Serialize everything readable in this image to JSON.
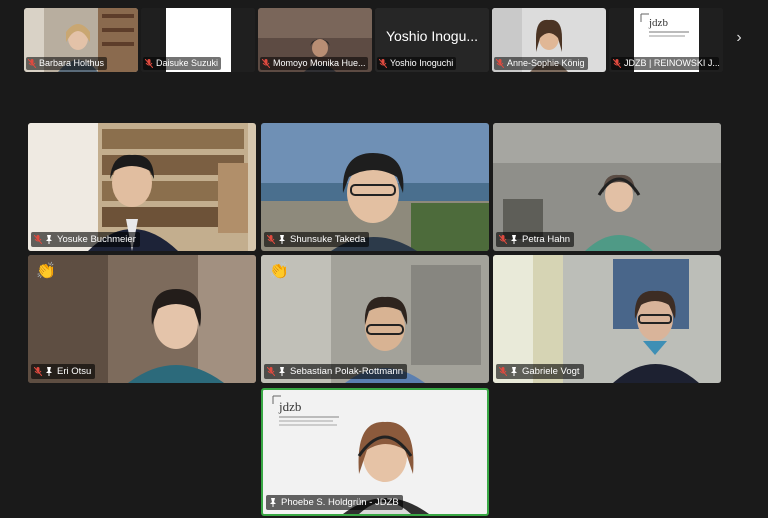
{
  "strip": {
    "thumbnails": [
      {
        "name": "Barbara Holthus",
        "bg": "#b7ad9e"
      },
      {
        "name": "Daisuke Suzuki",
        "bg": "#ffffff"
      },
      {
        "name": "Momoyo Monika Hue...",
        "bg": "#6e5a50"
      },
      {
        "name": "Yoshio Inoguchi",
        "big_name": "Yoshio Inogu...",
        "bg": "#262626"
      },
      {
        "name": "Anne-Sophie König",
        "bg": "#d9d9d9"
      },
      {
        "name": "JDZB | REINOWSKI J...",
        "bg": "#ffffff",
        "logo": "jdzb"
      }
    ],
    "next_icon": "chevron-right-icon",
    "next_glyph": "›"
  },
  "tiles": [
    {
      "name": "Yosuke Buchmeier",
      "bg": "#c9b79c"
    },
    {
      "name": "Shunsuke Takeda",
      "bg": "#7f97a8"
    },
    {
      "name": "Petra Hahn",
      "bg": "#8a8a86"
    },
    {
      "name": "Eri Otsu",
      "bg": "#8a7868",
      "hand": "👏"
    },
    {
      "name": "Sebastian Polak-Rottmann",
      "bg": "#9b9a92",
      "hand": "👏"
    },
    {
      "name": "Gabriele Vogt",
      "bg": "#b7b9b3"
    },
    {
      "name": "Phoebe S. Holdgrün - JDZB",
      "bg": "#f1f1f1",
      "logo": "jdzb",
      "active": true
    }
  ],
  "colors": {
    "active_border": "#39a845",
    "muted_mic": "#e04a3f"
  }
}
